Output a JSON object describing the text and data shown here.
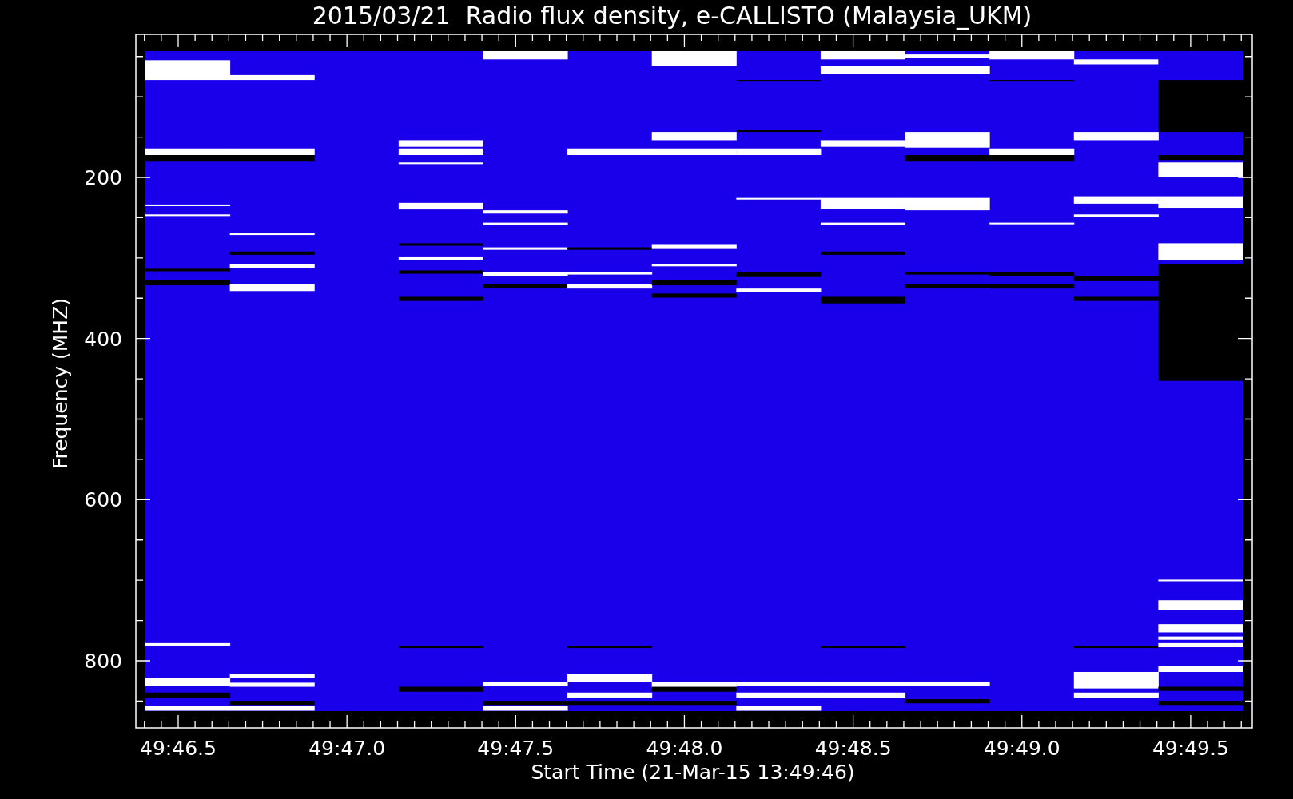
{
  "title": "2015/03/21  Radio flux density, e-CALLISTO (Malaysia_UKM)",
  "y_axis": {
    "label": "Frequency (MHZ)",
    "tick_labels": [
      "200",
      "400",
      "600",
      "800"
    ]
  },
  "x_axis": {
    "label": "Start Time (21-Mar-15 13:49:46)",
    "tick_labels": [
      "49:46.5",
      "49:47.0",
      "49:47.5",
      "49:48.0",
      "49:48.5",
      "49:49.0",
      "49:49.5"
    ]
  }
}
